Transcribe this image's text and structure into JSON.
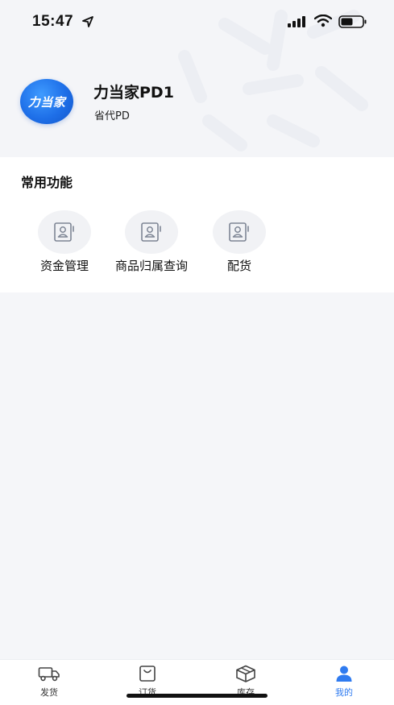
{
  "status_bar": {
    "time": "15:47"
  },
  "profile": {
    "avatar_text": "力当家",
    "name": "力当家PD1",
    "role": "省代PD"
  },
  "functions": {
    "title": "常用功能",
    "items": [
      {
        "label": "资金管理",
        "icon": "contact-card-icon"
      },
      {
        "label": "商品归属查询",
        "icon": "contact-card-icon"
      },
      {
        "label": "配货",
        "icon": "contact-card-icon"
      }
    ]
  },
  "tabs": [
    {
      "label": "发货",
      "icon": "truck-icon",
      "active": false
    },
    {
      "label": "订货",
      "icon": "bag-icon",
      "active": false
    },
    {
      "label": "库存",
      "icon": "box-icon",
      "active": false
    },
    {
      "label": "我的",
      "icon": "person-icon",
      "active": true
    }
  ],
  "colors": {
    "accent": "#2f7bf0",
    "avatar": "#1e6fe8",
    "background": "#f5f6f9"
  }
}
